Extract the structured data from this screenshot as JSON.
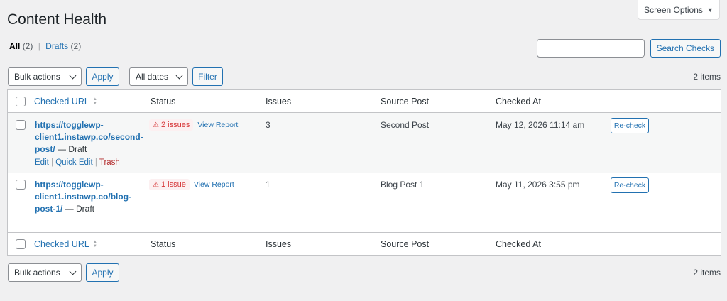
{
  "screen_options": {
    "label": "Screen Options"
  },
  "page": {
    "title": "Content Health"
  },
  "filters": [
    {
      "label": "All",
      "count": "(2)"
    },
    {
      "label": "Drafts",
      "count": "(2)"
    }
  ],
  "filter_separator": "|",
  "search": {
    "value": "",
    "placeholder": "",
    "button_label": "Search Checks"
  },
  "top_nav": {
    "bulk_actions": "Bulk actions",
    "apply": "Apply",
    "dates": "All dates",
    "filter": "Filter",
    "items_count": "2 items"
  },
  "bottom_nav": {
    "bulk_actions": "Bulk actions",
    "apply": "Apply",
    "items_count": "2 items"
  },
  "columns": {
    "checked_url": "Checked URL",
    "status": "Status",
    "issues": "Issues",
    "source_post": "Source Post",
    "checked_at": "Checked At"
  },
  "rows": [
    {
      "url_lines": [
        "https://togglewp-",
        "client1.instawp.co/second-",
        "post/"
      ],
      "suffix": " — Draft",
      "status_badge": "2 issues",
      "view_report": "View Report",
      "issues": "3",
      "source_post": "Second Post",
      "checked_at": "May 12, 2026 11:14 am",
      "recheck": "Re-check",
      "actions": {
        "edit": "Edit",
        "quick_edit": "Quick Edit",
        "trash": "Trash",
        "sep": "|"
      }
    },
    {
      "url_lines": [
        "https://togglewp-",
        "client1.instawp.co/blog-",
        "post-1/"
      ],
      "suffix": " — Draft",
      "status_badge": "1 issue",
      "view_report": "View Report",
      "issues": "1",
      "source_post": "Blog Post 1",
      "checked_at": "May 11, 2026 3:55 pm",
      "recheck": "Re-check"
    }
  ],
  "colors": {
    "accent": "#2271b1",
    "danger": "#d63638",
    "badge_bg": "#fcf0f1",
    "background": "#f0f0f1"
  },
  "icons": {
    "warning": "warning-icon",
    "sort": "sort-icon",
    "dropdown": "chevron-down-icon"
  }
}
